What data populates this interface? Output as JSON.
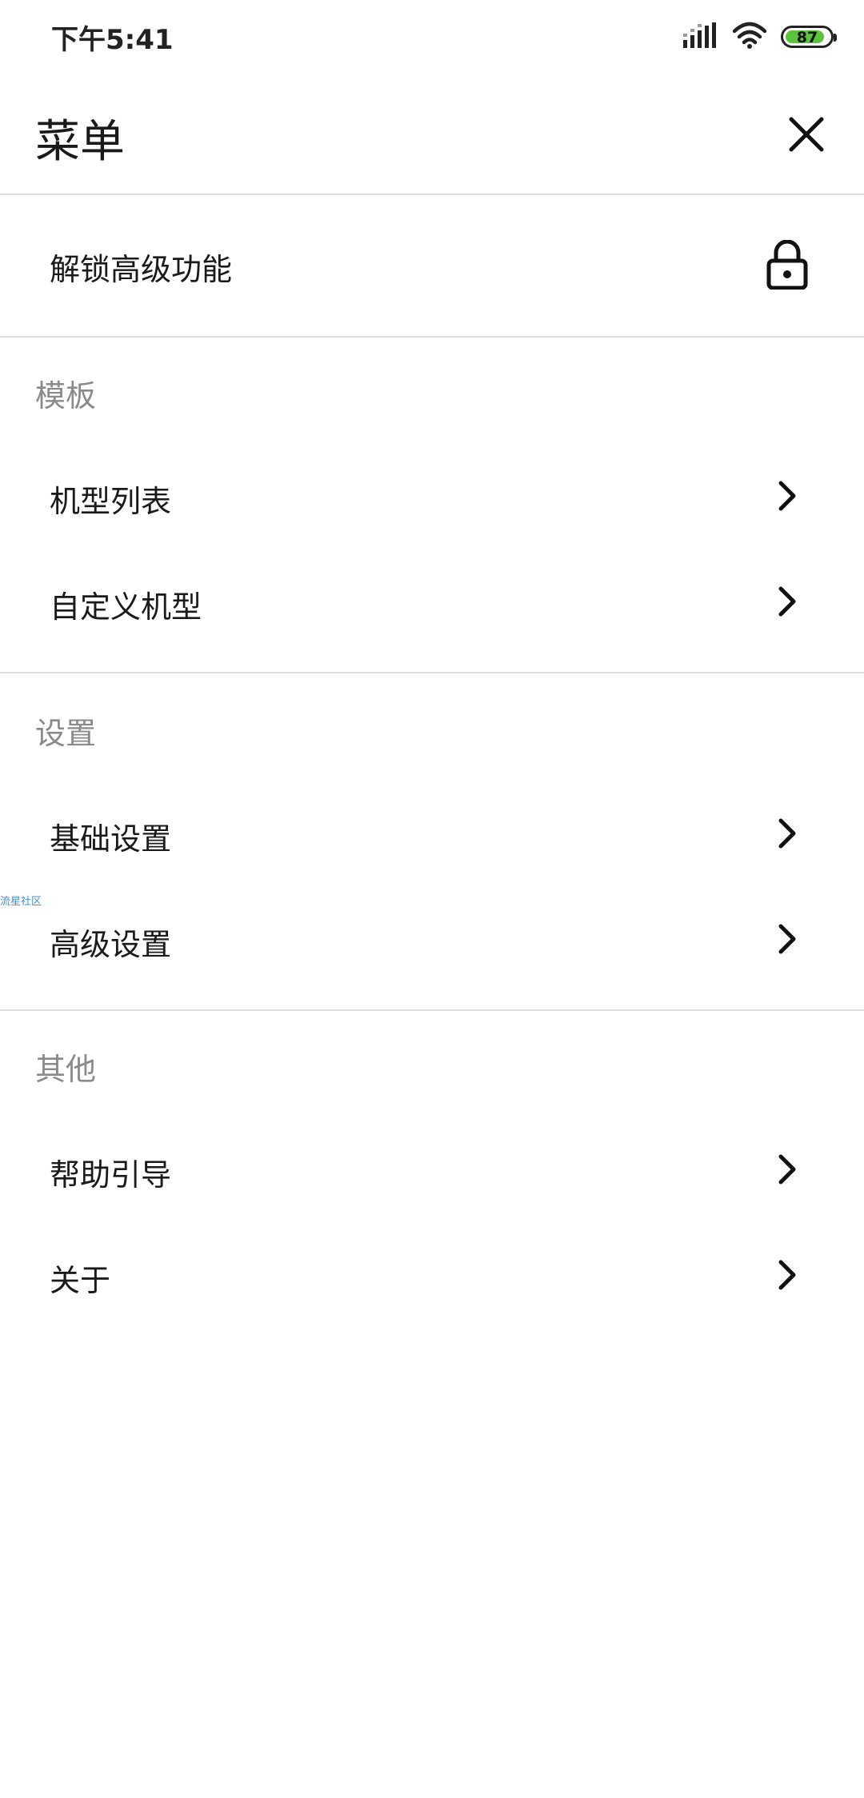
{
  "status_bar": {
    "time": "下午5:41",
    "battery_level": "87",
    "icons": [
      "signal-icon",
      "wifi-icon",
      "battery-icon"
    ]
  },
  "header": {
    "title": "菜单",
    "close_icon": "close-icon"
  },
  "unlock": {
    "label": "解锁高级功能",
    "icon": "lock-icon"
  },
  "sections": [
    {
      "title": "模板",
      "items": [
        {
          "label": "机型列表"
        },
        {
          "label": "自定义机型"
        }
      ]
    },
    {
      "title": "设置",
      "items": [
        {
          "label": "基础设置"
        },
        {
          "label": "高级设置"
        }
      ]
    },
    {
      "title": "其他",
      "items": [
        {
          "label": "帮助引导"
        },
        {
          "label": "关于"
        }
      ]
    }
  ],
  "watermark": "流星社区",
  "colors": {
    "battery": "#5cc43a",
    "section_title": "#8a8a8a",
    "divider": "#dcdcdc"
  }
}
